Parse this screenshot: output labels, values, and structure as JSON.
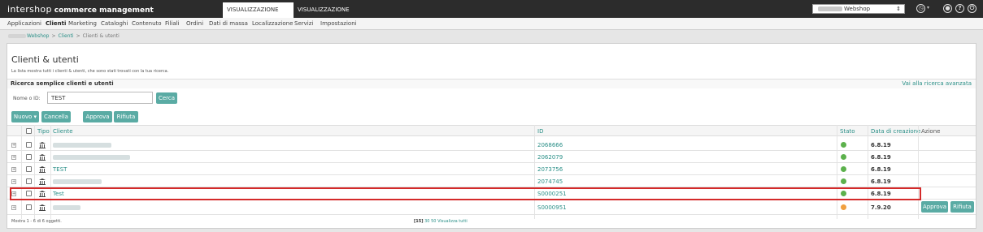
{
  "brand": {
    "name": "intershop",
    "sub": "commerce management"
  },
  "top_tabs": [
    {
      "label": "VISUALIZZAZIONE DATI"
    },
    {
      "label": "VISUALIZZAZIONE DESIGN"
    }
  ],
  "site_select": {
    "value": "Webshop"
  },
  "nav": [
    "Applicazioni",
    "Clienti",
    "Marketing",
    "Cataloghi",
    "Contenuto",
    "Filiali",
    "Ordini",
    "Dati di massa",
    "Localizzazione",
    "Servizi",
    "Impostazioni"
  ],
  "breadcrumb": {
    "site": "Webshop",
    "section": "Clienti",
    "current": "Clienti & utenti"
  },
  "page": {
    "title": "Clienti & utenti",
    "description": "La lista mostra tutti i clienti & utenti, che sono stati trovati con la tua ricerca.",
    "search_title": "Ricerca semplice clienti e utenti",
    "advanced_link": "Vai alla ricerca avanzata",
    "name_label": "Nome o ID:",
    "search_value": "TEST",
    "search_button": "Cerca"
  },
  "actions": {
    "new": "Nuovo",
    "delete": "Cancella",
    "approve": "Approva",
    "reject": "Rifiuta"
  },
  "table": {
    "headers": {
      "type": "Tipo",
      "customer": "Cliente",
      "id": "ID",
      "status": "Stato",
      "created": "Data di creazione",
      "action": "Azione"
    },
    "rows": [
      {
        "name": "",
        "id": "2068666",
        "status": "ok",
        "date": "6.8.19"
      },
      {
        "name": "",
        "id": "2062079",
        "status": "ok",
        "date": "6.8.19"
      },
      {
        "name": "TEST",
        "id": "2073756",
        "status": "ok",
        "date": "6.8.19"
      },
      {
        "name": "",
        "id": "2074745",
        "status": "ok",
        "date": "6.8.19"
      },
      {
        "name": "Test",
        "id": "S0000251",
        "status": "ok",
        "date": "6.8.19"
      },
      {
        "name": "",
        "id": "S0000951",
        "status": "pending",
        "date": "7.9.20"
      }
    ],
    "row_actions": {
      "approve": "Approva",
      "reject": "Rifiuta"
    }
  },
  "footer": {
    "count_text": "Mostra 1 - 6 di 6 oggetti.",
    "pager_current": "[15]",
    "pager_options": [
      "30",
      "50",
      "Visualizza tutti"
    ]
  },
  "colors": {
    "accent": "#5aaba4",
    "link": "#2a8f87",
    "ok": "#5cb14c",
    "pending": "#f0a040",
    "highlight": "#d42a2a"
  }
}
